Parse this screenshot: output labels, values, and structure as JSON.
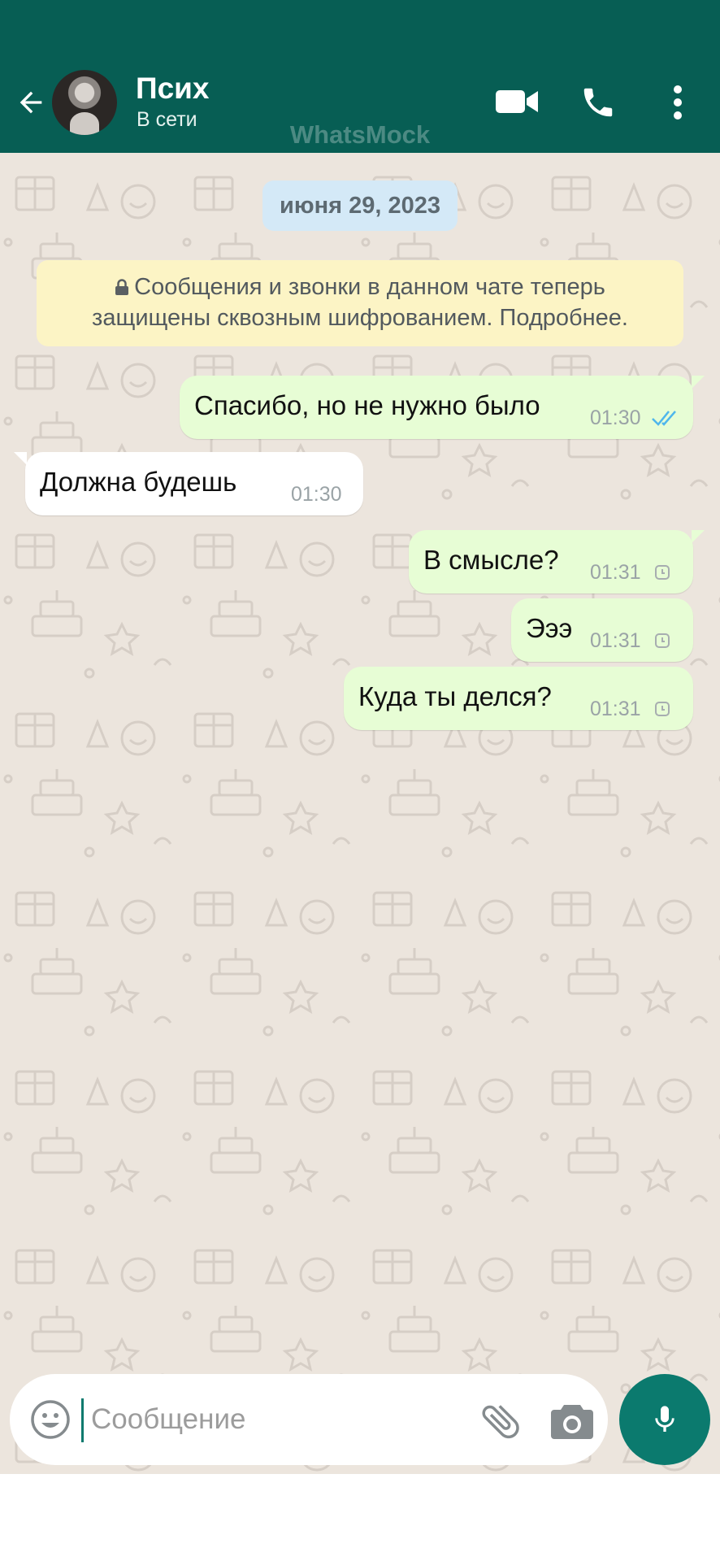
{
  "header": {
    "contact_name": "Псих",
    "status": "В сети",
    "watermark": "WhatsMock",
    "icons": [
      "back-arrow-icon",
      "video-call-icon",
      "phone-icon",
      "more-vert-icon"
    ],
    "background_color": "#075e54"
  },
  "chat": {
    "date_chip": "июня 29, 2023",
    "encryption_notice_line1": "Сообщения и звонки в данном чате теперь",
    "encryption_notice_line2": "защищены сквозным шифрованием. Подробнее.",
    "messages": [
      {
        "direction": "out",
        "text": "Спасибо, но не нужно было",
        "time": "01:30",
        "status": "read"
      },
      {
        "direction": "in",
        "text": "Должна будешь",
        "time": "01:30"
      },
      {
        "direction": "out",
        "text": "В смысле?",
        "time": "01:31",
        "status": "pending"
      },
      {
        "direction": "out",
        "text": "Эээ",
        "time": "01:31",
        "status": "pending"
      },
      {
        "direction": "out",
        "text": "Куда ты делся?",
        "time": "01:31",
        "status": "pending"
      }
    ],
    "background_color": "#ece5dd",
    "outgoing_bubble_color": "#e7fdd5"
  },
  "composer": {
    "placeholder": "Сообщение",
    "icons": [
      "emoji-icon",
      "attach-icon",
      "camera-icon",
      "mic-icon"
    ],
    "accent_color": "#0b7a6e"
  }
}
